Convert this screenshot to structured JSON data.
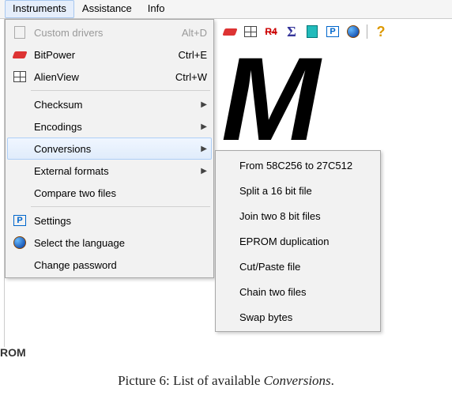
{
  "menubar": {
    "instruments": "Instruments",
    "assistance": "Assistance",
    "info": "Info"
  },
  "dropdown": {
    "custom_drivers": {
      "label": "Custom drivers",
      "shortcut": "Alt+D"
    },
    "bitpower": {
      "label": "BitPower",
      "shortcut": "Ctrl+E"
    },
    "alienview": {
      "label": "AlienView",
      "shortcut": "Ctrl+W"
    },
    "checksum": {
      "label": "Checksum"
    },
    "encodings": {
      "label": "Encodings"
    },
    "conversions": {
      "label": "Conversions"
    },
    "external_formats": {
      "label": "External formats"
    },
    "compare": {
      "label": "Compare two files"
    },
    "settings": {
      "label": "Settings"
    },
    "language": {
      "label": "Select the language"
    },
    "change_pw": {
      "label": "Change password"
    }
  },
  "submenu": {
    "i0": "From 58C256 to 27C512",
    "i1": "Split a 16 bit file",
    "i2": "Join two 8 bit files",
    "i3": "EPROM duplication",
    "i4": "Cut/Paste file",
    "i5": "Chain two files",
    "i6": "Swap bytes"
  },
  "frag": {
    "rom": "ROM"
  },
  "caption": {
    "prefix": "Picture 6: List of available ",
    "em": "Conversions",
    "suffix": "."
  },
  "icons": {
    "grid": "grid-icon",
    "red": "R4",
    "sigma": "Σ",
    "teal": "teal",
    "p": "P",
    "globe": "globe",
    "q": "?"
  }
}
